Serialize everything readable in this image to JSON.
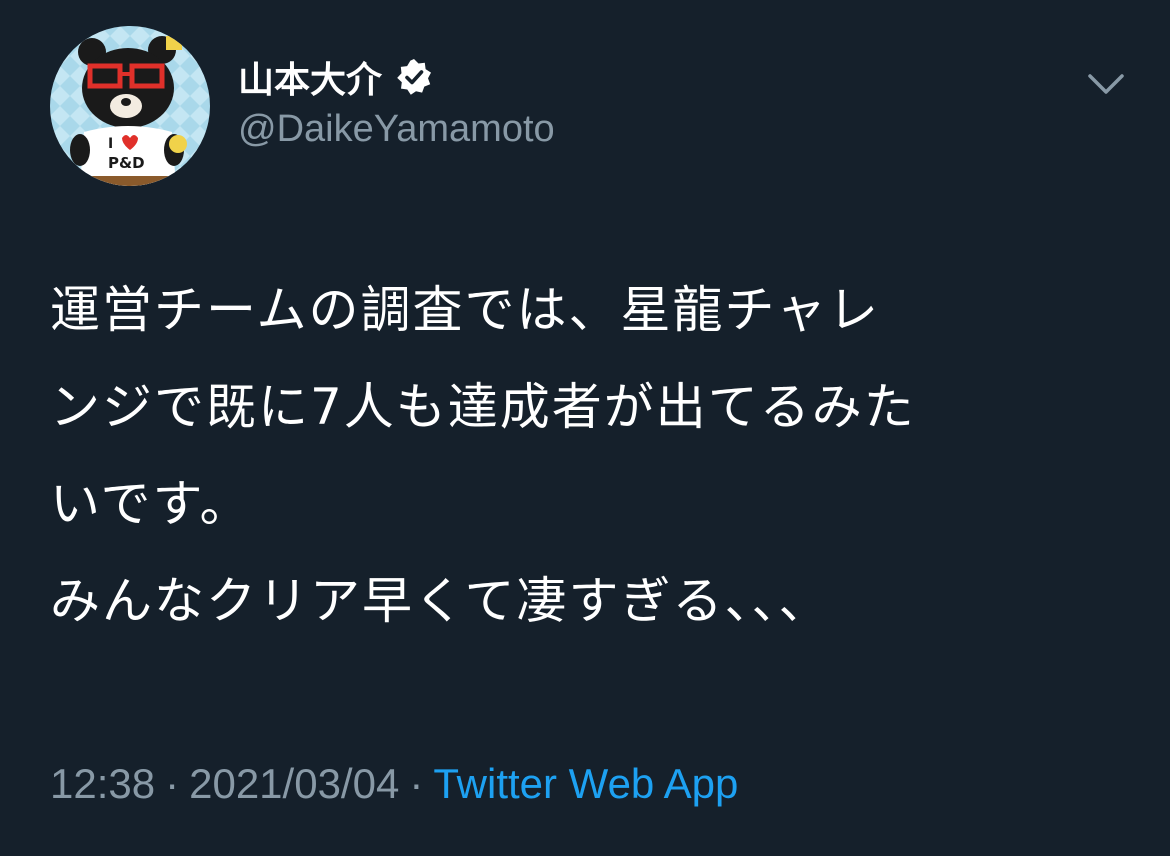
{
  "author": {
    "display_name": "山本大介",
    "handle": "@DaikeYamamoto",
    "verified": true,
    "verified_icon": "verified-badge-icon",
    "avatar_text": "I ❤ P&D"
  },
  "menu_icon": "chevron-down-icon",
  "tweet": {
    "lines": [
      "運営チームの調査では、星龍チャレ",
      "ンジで既に7人も達成者が出てるみた",
      "いです。",
      "みんなクリア早くて凄すぎる、、、"
    ]
  },
  "meta": {
    "time": "12:38",
    "separator": "·",
    "date": "2021/03/04",
    "source": "Twitter Web App"
  },
  "colors": {
    "background": "#15202b",
    "primary_text": "#ffffff",
    "secondary_text": "#8899a6",
    "link": "#1da1f2"
  }
}
